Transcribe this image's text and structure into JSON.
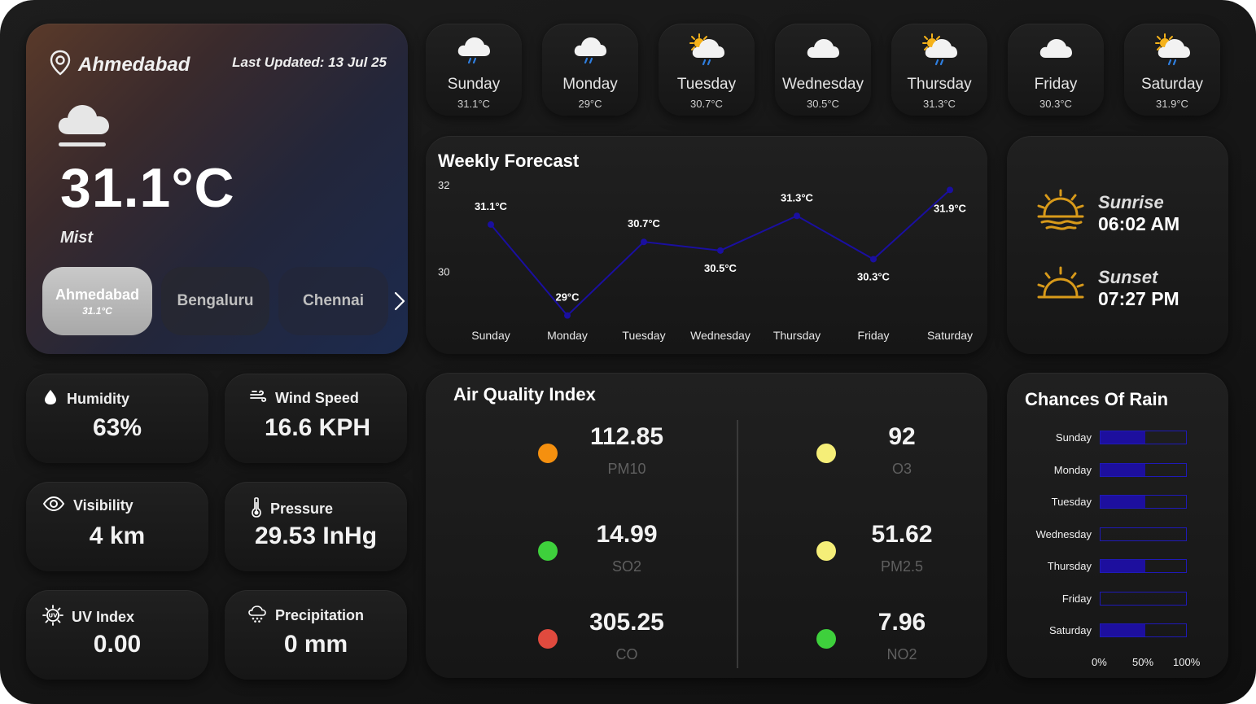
{
  "location": {
    "city": "Ahmedabad",
    "last_updated": "Last Updated: 13 Jul 25"
  },
  "current": {
    "temperature": "31.1°C",
    "condition": "Mist",
    "icon": "mist-cloud-icon"
  },
  "cities": [
    {
      "name": "Ahmedabad",
      "temp": "31.1°C",
      "active": true
    },
    {
      "name": "Bengaluru"
    },
    {
      "name": "Chennai"
    }
  ],
  "days": [
    {
      "name": "Sunday",
      "temp": "31.1°C",
      "icon": "cloud-rain-icon"
    },
    {
      "name": "Monday",
      "temp": "29°C",
      "icon": "cloud-rain-icon"
    },
    {
      "name": "Tuesday",
      "temp": "30.7°C",
      "icon": "sun-cloud-rain-icon"
    },
    {
      "name": "Wednesday",
      "temp": "30.5°C",
      "icon": "cloud-icon"
    },
    {
      "name": "Thursday",
      "temp": "31.3°C",
      "icon": "sun-cloud-rain-icon"
    },
    {
      "name": "Friday",
      "temp": "30.3°C",
      "icon": "cloud-icon"
    },
    {
      "name": "Saturday",
      "temp": "31.9°C",
      "icon": "sun-cloud-rain-icon"
    }
  ],
  "forecast": {
    "title": "Weekly Forecast",
    "chart_data": {
      "type": "line",
      "categories": [
        "Sunday",
        "Monday",
        "Tuesday",
        "Wednesday",
        "Thursday",
        "Friday",
        "Saturday"
      ],
      "values": [
        31.1,
        29,
        30.7,
        30.5,
        31.3,
        30.3,
        31.9
      ],
      "labels": [
        "31.1°C",
        "29°C",
        "30.7°C",
        "30.5°C",
        "31.3°C",
        "30.3°C",
        "31.9°C"
      ],
      "yticks": [
        "32",
        "30"
      ],
      "ylim": [
        28.9,
        32
      ],
      "color": "#1a0fa0"
    }
  },
  "sun": {
    "sunrise_label": "Sunrise",
    "sunrise_time": "06:02 AM",
    "sunset_label": "Sunset",
    "sunset_time": "07:27 PM",
    "color": "#d89a1a"
  },
  "stats": {
    "humidity": {
      "label": "Humidity",
      "value": "63%"
    },
    "wind": {
      "label": "Wind Speed",
      "value": "16.6 KPH"
    },
    "visibility": {
      "label": "Visibility",
      "value": "4 km"
    },
    "pressure": {
      "label": "Pressure",
      "value": "29.53 InHg"
    },
    "uv": {
      "label": "UV Index",
      "value": "0.00"
    },
    "precipitation": {
      "label": "Precipitation",
      "value": "0 mm"
    }
  },
  "aqi": {
    "title": "Air Quality Index",
    "items": [
      {
        "value": "112.85",
        "name": "PM10",
        "color": "#f5900f"
      },
      {
        "value": "92",
        "name": "O3",
        "color": "#f5ee78"
      },
      {
        "value": "14.99",
        "name": "SO2",
        "color": "#3ed03c"
      },
      {
        "value": "51.62",
        "name": "PM2.5",
        "color": "#f5ee78"
      },
      {
        "value": "305.25",
        "name": "CO",
        "color": "#e04a3e"
      },
      {
        "value": "7.96",
        "name": "NO2",
        "color": "#3ed03c"
      }
    ]
  },
  "rain": {
    "title": "Chances Of Rain",
    "chart_data": {
      "type": "bar",
      "categories": [
        "Sunday",
        "Monday",
        "Tuesday",
        "Wednesday",
        "Thursday",
        "Friday",
        "Saturday"
      ],
      "values": [
        52,
        52,
        52,
        0,
        52,
        0,
        52
      ],
      "xticks": [
        "0%",
        "50%",
        "100%"
      ],
      "xlim": [
        0,
        100
      ],
      "color": "#1d0f9e"
    }
  }
}
